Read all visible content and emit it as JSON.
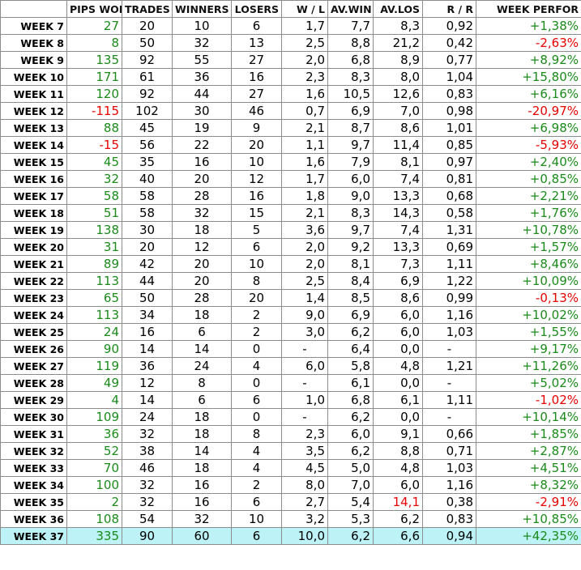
{
  "colors": {
    "positive": "#1a8a1a",
    "negative": "#e60000",
    "highlight_row": "#bdf3f6"
  },
  "headers": [
    "",
    "PIPS WON",
    "TRADES",
    "WINNERS",
    "LOSERS",
    "W / L",
    "AV.WIN",
    "AV.LOS",
    "R / R",
    "WEEK PERFOR"
  ],
  "rows": [
    {
      "week": "WEEK 7",
      "pips": "27",
      "trades": "20",
      "winners": "10",
      "losers": "6",
      "wl": "1,7",
      "avwin": "7,7",
      "avlos": "8,3",
      "rr": "0,92",
      "perf": "+1,38%"
    },
    {
      "week": "WEEK 8",
      "pips": "8",
      "trades": "50",
      "winners": "32",
      "losers": "13",
      "wl": "2,5",
      "avwin": "8,8",
      "avlos": "21,2",
      "rr": "0,42",
      "perf": "-2,63%"
    },
    {
      "week": "WEEK 9",
      "pips": "135",
      "trades": "92",
      "winners": "55",
      "losers": "27",
      "wl": "2,0",
      "avwin": "6,8",
      "avlos": "8,9",
      "rr": "0,77",
      "perf": "+8,92%"
    },
    {
      "week": "WEEK 10",
      "pips": "171",
      "trades": "61",
      "winners": "36",
      "losers": "16",
      "wl": "2,3",
      "avwin": "8,3",
      "avlos": "8,0",
      "rr": "1,04",
      "perf": "+15,80%"
    },
    {
      "week": "WEEK 11",
      "pips": "120",
      "trades": "92",
      "winners": "44",
      "losers": "27",
      "wl": "1,6",
      "avwin": "10,5",
      "avlos": "12,6",
      "rr": "0,83",
      "perf": "+6,16%"
    },
    {
      "week": "WEEK 12",
      "pips": "-115",
      "trades": "102",
      "winners": "30",
      "losers": "46",
      "wl": "0,7",
      "avwin": "6,9",
      "avlos": "7,0",
      "rr": "0,98",
      "perf": "-20,97%"
    },
    {
      "week": "WEEK 13",
      "pips": "88",
      "trades": "45",
      "winners": "19",
      "losers": "9",
      "wl": "2,1",
      "avwin": "8,7",
      "avlos": "8,6",
      "rr": "1,01",
      "perf": "+6,98%"
    },
    {
      "week": "WEEK 14",
      "pips": "-15",
      "trades": "56",
      "winners": "22",
      "losers": "20",
      "wl": "1,1",
      "avwin": "9,7",
      "avlos": "11,4",
      "rr": "0,85",
      "perf": "-5,93%"
    },
    {
      "week": "WEEK 15",
      "pips": "45",
      "trades": "35",
      "winners": "16",
      "losers": "10",
      "wl": "1,6",
      "avwin": "7,9",
      "avlos": "8,1",
      "rr": "0,97",
      "perf": "+2,40%"
    },
    {
      "week": "WEEK 16",
      "pips": "32",
      "trades": "40",
      "winners": "20",
      "losers": "12",
      "wl": "1,7",
      "avwin": "6,0",
      "avlos": "7,4",
      "rr": "0,81",
      "perf": "+0,85%"
    },
    {
      "week": "WEEK 17",
      "pips": "58",
      "trades": "58",
      "winners": "28",
      "losers": "16",
      "wl": "1,8",
      "avwin": "9,0",
      "avlos": "13,3",
      "rr": "0,68",
      "perf": "+2,21%"
    },
    {
      "week": "WEEK 18",
      "pips": "51",
      "trades": "58",
      "winners": "32",
      "losers": "15",
      "wl": "2,1",
      "avwin": "8,3",
      "avlos": "14,3",
      "rr": "0,58",
      "perf": "+1,76%"
    },
    {
      "week": "WEEK 19",
      "pips": "138",
      "trades": "30",
      "winners": "18",
      "losers": "5",
      "wl": "3,6",
      "avwin": "9,7",
      "avlos": "7,4",
      "rr": "1,31",
      "perf": "+10,78%"
    },
    {
      "week": "WEEK 20",
      "pips": "31",
      "trades": "20",
      "winners": "12",
      "losers": "6",
      "wl": "2,0",
      "avwin": "9,2",
      "avlos": "13,3",
      "rr": "0,69",
      "perf": "+1,57%"
    },
    {
      "week": "WEEK 21",
      "pips": "89",
      "trades": "42",
      "winners": "20",
      "losers": "10",
      "wl": "2,0",
      "avwin": "8,1",
      "avlos": "7,3",
      "rr": "1,11",
      "perf": "+8,46%"
    },
    {
      "week": "WEEK 22",
      "pips": "113",
      "trades": "44",
      "winners": "20",
      "losers": "8",
      "wl": "2,5",
      "avwin": "8,4",
      "avlos": "6,9",
      "rr": "1,22",
      "perf": "+10,09%"
    },
    {
      "week": "WEEK 23",
      "pips": "65",
      "trades": "50",
      "winners": "28",
      "losers": "20",
      "wl": "1,4",
      "avwin": "8,5",
      "avlos": "8,6",
      "rr": "0,99",
      "perf": "-0,13%"
    },
    {
      "week": "WEEK 24",
      "pips": "113",
      "trades": "34",
      "winners": "18",
      "losers": "2",
      "wl": "9,0",
      "avwin": "6,9",
      "avlos": "6,0",
      "rr": "1,16",
      "perf": "+10,02%"
    },
    {
      "week": "WEEK 25",
      "pips": "24",
      "trades": "16",
      "winners": "6",
      "losers": "2",
      "wl": "3,0",
      "avwin": "6,2",
      "avlos": "6,0",
      "rr": "1,03",
      "perf": "+1,55%"
    },
    {
      "week": "WEEK 26",
      "pips": "90",
      "trades": "14",
      "winners": "14",
      "losers": "0",
      "wl": "-",
      "avwin": "6,4",
      "avlos": "0,0",
      "rr": "-",
      "perf": "+9,17%"
    },
    {
      "week": "WEEK 27",
      "pips": "119",
      "trades": "36",
      "winners": "24",
      "losers": "4",
      "wl": "6,0",
      "avwin": "5,8",
      "avlos": "4,8",
      "rr": "1,21",
      "perf": "+11,26%"
    },
    {
      "week": "WEEK 28",
      "pips": "49",
      "trades": "12",
      "winners": "8",
      "losers": "0",
      "wl": "-",
      "avwin": "6,1",
      "avlos": "0,0",
      "rr": "-",
      "perf": "+5,02%"
    },
    {
      "week": "WEEK 29",
      "pips": "4",
      "trades": "14",
      "winners": "6",
      "losers": "6",
      "wl": "1,0",
      "avwin": "6,8",
      "avlos": "6,1",
      "rr": "1,11",
      "perf": "-1,02%"
    },
    {
      "week": "WEEK 30",
      "pips": "109",
      "trades": "24",
      "winners": "18",
      "losers": "0",
      "wl": "-",
      "avwin": "6,2",
      "avlos": "0,0",
      "rr": "-",
      "perf": "+10,14%"
    },
    {
      "week": "WEEK 31",
      "pips": "36",
      "trades": "32",
      "winners": "18",
      "losers": "8",
      "wl": "2,3",
      "avwin": "6,0",
      "avlos": "9,1",
      "rr": "0,66",
      "perf": "+1,85%"
    },
    {
      "week": "WEEK 32",
      "pips": "52",
      "trades": "38",
      "winners": "14",
      "losers": "4",
      "wl": "3,5",
      "avwin": "6,2",
      "avlos": "8,8",
      "rr": "0,71",
      "perf": "+2,87%"
    },
    {
      "week": "WEEK 33",
      "pips": "70",
      "trades": "46",
      "winners": "18",
      "losers": "4",
      "wl": "4,5",
      "avwin": "5,0",
      "avlos": "4,8",
      "rr": "1,03",
      "perf": "+4,51%"
    },
    {
      "week": "WEEK 34",
      "pips": "100",
      "trades": "32",
      "winners": "16",
      "losers": "2",
      "wl": "8,0",
      "avwin": "7,0",
      "avlos": "6,0",
      "rr": "1,16",
      "perf": "+8,32%"
    },
    {
      "week": "WEEK 35",
      "pips": "2",
      "trades": "32",
      "winners": "16",
      "losers": "6",
      "wl": "2,7",
      "avwin": "5,4",
      "avlos": "14,1",
      "rr": "0,38",
      "perf": "-2,91%",
      "avlos_negative": true
    },
    {
      "week": "WEEK 36",
      "pips": "108",
      "trades": "54",
      "winners": "32",
      "losers": "10",
      "wl": "3,2",
      "avwin": "5,3",
      "avlos": "6,2",
      "rr": "0,83",
      "perf": "+10,85%"
    },
    {
      "week": "WEEK 37",
      "pips": "335",
      "trades": "90",
      "winners": "60",
      "losers": "6",
      "wl": "10,0",
      "avwin": "6,2",
      "avlos": "6,6",
      "rr": "0,94",
      "perf": "+42,35%",
      "highlight": true
    }
  ]
}
